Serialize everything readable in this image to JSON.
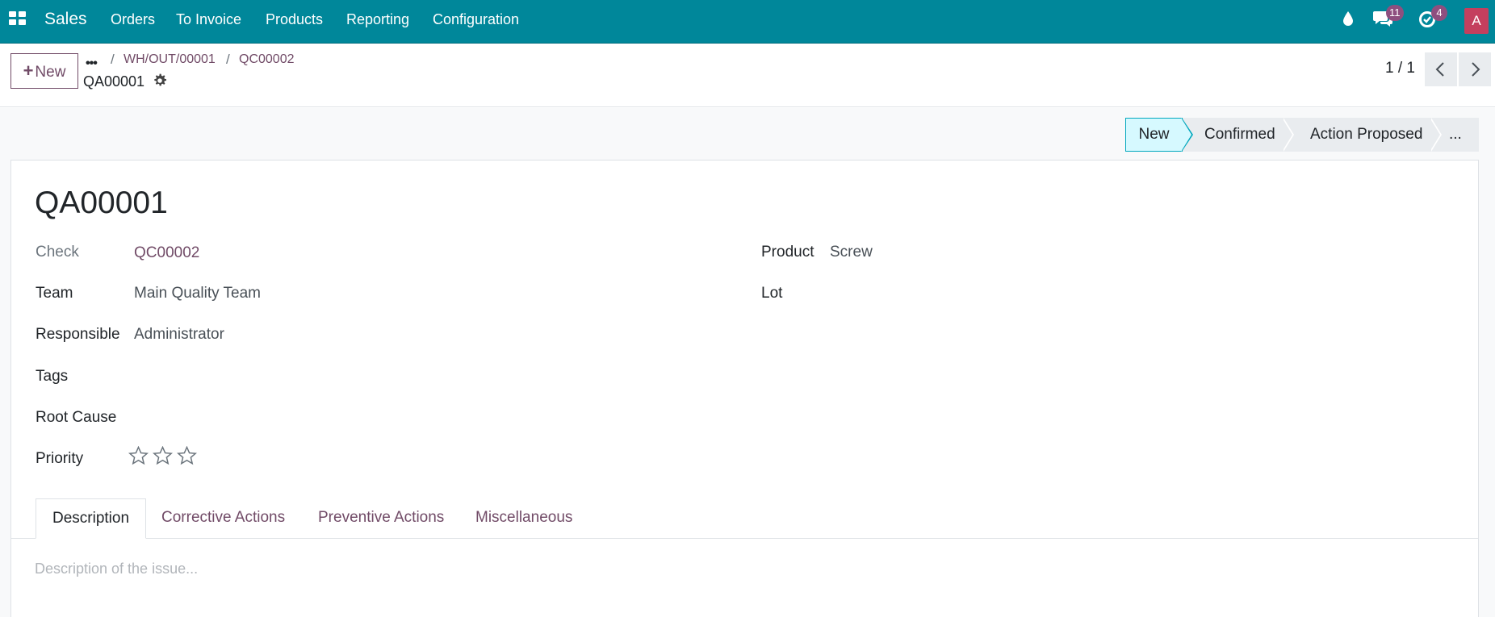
{
  "navbar": {
    "app_name": "Sales",
    "menu": [
      "Orders",
      "To Invoice",
      "Products",
      "Reporting",
      "Configuration"
    ],
    "messages_count": "11",
    "activities_count": "4",
    "user_initial": "A",
    "color": "#00879a"
  },
  "control_panel": {
    "new_label": "New",
    "breadcrumb": [
      "WH/OUT/00001",
      "QC00002"
    ],
    "record_name": "QA00001",
    "pager": "1 / 1"
  },
  "statusbar": {
    "stages": [
      "New",
      "Confirmed",
      "Action Proposed",
      "..."
    ],
    "active": "New"
  },
  "form": {
    "title": "QA00001",
    "check_label": "Check",
    "check_value": "QC00002",
    "team_label": "Team",
    "team_value": "Main Quality Team",
    "responsible_label": "Responsible",
    "responsible_value": "Administrator",
    "tags_label": "Tags",
    "root_cause_label": "Root Cause",
    "priority_label": "Priority",
    "priority_stars": 0,
    "priority_max": 3,
    "product_label": "Product",
    "product_value": "Screw",
    "lot_label": "Lot"
  },
  "tabs": [
    {
      "label": "Description",
      "active": true
    },
    {
      "label": "Corrective Actions",
      "active": false
    },
    {
      "label": "Preventive Actions",
      "active": false
    },
    {
      "label": "Miscellaneous",
      "active": false
    }
  ],
  "description": {
    "placeholder": "Description of the issue...",
    "value": ""
  },
  "icons": [
    "apps-grid-icon",
    "droplet-icon",
    "chat-icon",
    "clock-check-icon",
    "gear-icon",
    "chevron-left-icon",
    "chevron-right-icon",
    "star-icon"
  ],
  "colors": {
    "accent": "#714b67",
    "stage_active_bg": "#d6f9ff",
    "stage_active_border": "#00a7bd",
    "avatar": "#c43f5e",
    "badge": "#8e4f7f"
  }
}
